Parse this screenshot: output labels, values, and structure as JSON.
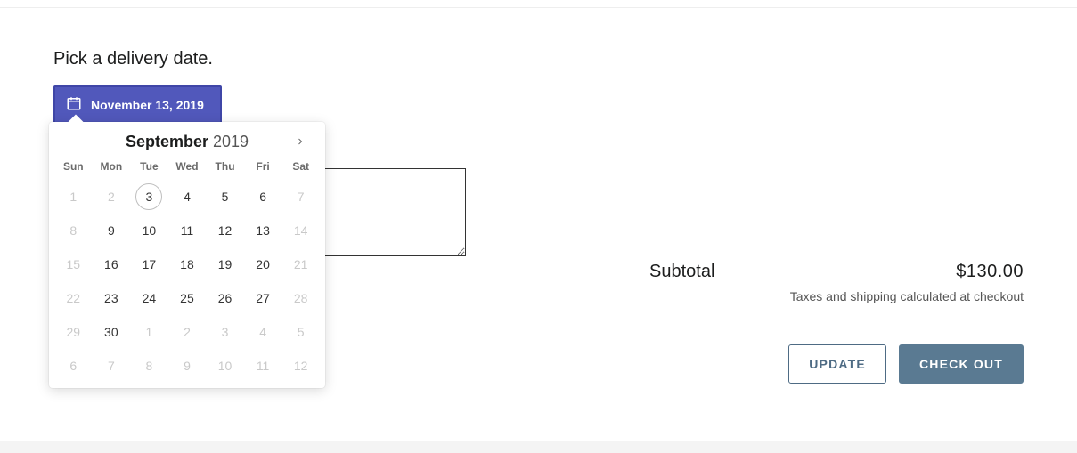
{
  "prompt": "Pick a delivery date.",
  "date_button": {
    "label": "November 13, 2019"
  },
  "calendar": {
    "month": "September",
    "year": "2019",
    "weekdays": [
      "Sun",
      "Mon",
      "Tue",
      "Wed",
      "Thu",
      "Fri",
      "Sat"
    ],
    "weeks": [
      [
        {
          "d": "1",
          "dim": true
        },
        {
          "d": "2",
          "dim": true
        },
        {
          "d": "3",
          "dim": false,
          "today": true
        },
        {
          "d": "4",
          "dim": false
        },
        {
          "d": "5",
          "dim": false
        },
        {
          "d": "6",
          "dim": false
        },
        {
          "d": "7",
          "dim": true
        }
      ],
      [
        {
          "d": "8",
          "dim": true
        },
        {
          "d": "9",
          "dim": false
        },
        {
          "d": "10",
          "dim": false
        },
        {
          "d": "11",
          "dim": false
        },
        {
          "d": "12",
          "dim": false
        },
        {
          "d": "13",
          "dim": false
        },
        {
          "d": "14",
          "dim": true
        }
      ],
      [
        {
          "d": "15",
          "dim": true
        },
        {
          "d": "16",
          "dim": false
        },
        {
          "d": "17",
          "dim": false
        },
        {
          "d": "18",
          "dim": false
        },
        {
          "d": "19",
          "dim": false
        },
        {
          "d": "20",
          "dim": false
        },
        {
          "d": "21",
          "dim": true
        }
      ],
      [
        {
          "d": "22",
          "dim": true
        },
        {
          "d": "23",
          "dim": false
        },
        {
          "d": "24",
          "dim": false
        },
        {
          "d": "25",
          "dim": false
        },
        {
          "d": "26",
          "dim": false
        },
        {
          "d": "27",
          "dim": false
        },
        {
          "d": "28",
          "dim": true
        }
      ],
      [
        {
          "d": "29",
          "dim": true
        },
        {
          "d": "30",
          "dim": false
        },
        {
          "d": "1",
          "dim": true
        },
        {
          "d": "2",
          "dim": true
        },
        {
          "d": "3",
          "dim": true
        },
        {
          "d": "4",
          "dim": true
        },
        {
          "d": "5",
          "dim": true
        }
      ],
      [
        {
          "d": "6",
          "dim": true
        },
        {
          "d": "7",
          "dim": true
        },
        {
          "d": "8",
          "dim": true
        },
        {
          "d": "9",
          "dim": true
        },
        {
          "d": "10",
          "dim": true
        },
        {
          "d": "11",
          "dim": true
        },
        {
          "d": "12",
          "dim": true
        }
      ]
    ]
  },
  "notes": {
    "value": ""
  },
  "summary": {
    "subtotal_label": "Subtotal",
    "subtotal_amount": "$130.00",
    "tax_note": "Taxes and shipping calculated at checkout"
  },
  "buttons": {
    "update": "UPDATE",
    "checkout": "CHECK OUT"
  }
}
